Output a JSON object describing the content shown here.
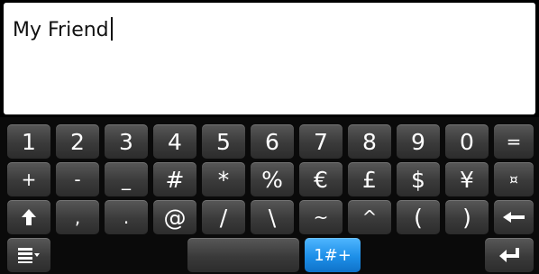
{
  "text_field": {
    "value": "My Friend"
  },
  "rows": [
    [
      "1",
      "2",
      "3",
      "4",
      "5",
      "6",
      "7",
      "8",
      "9",
      "0",
      "="
    ],
    [
      "+",
      "-",
      "_",
      "#",
      "*",
      "%",
      "€",
      "£",
      "$",
      "¥",
      "¤"
    ],
    [
      "",
      ",",
      ".",
      "@",
      "/",
      "\\",
      "~",
      "^",
      "(",
      ")",
      ""
    ]
  ],
  "bottom": {
    "mode_key": "1#+"
  },
  "icons": {
    "shift": "shift-up-arrow-icon",
    "backspace": "backspace-arrow-icon",
    "menu": "menu-lines-icon",
    "enter": "enter-return-icon"
  }
}
